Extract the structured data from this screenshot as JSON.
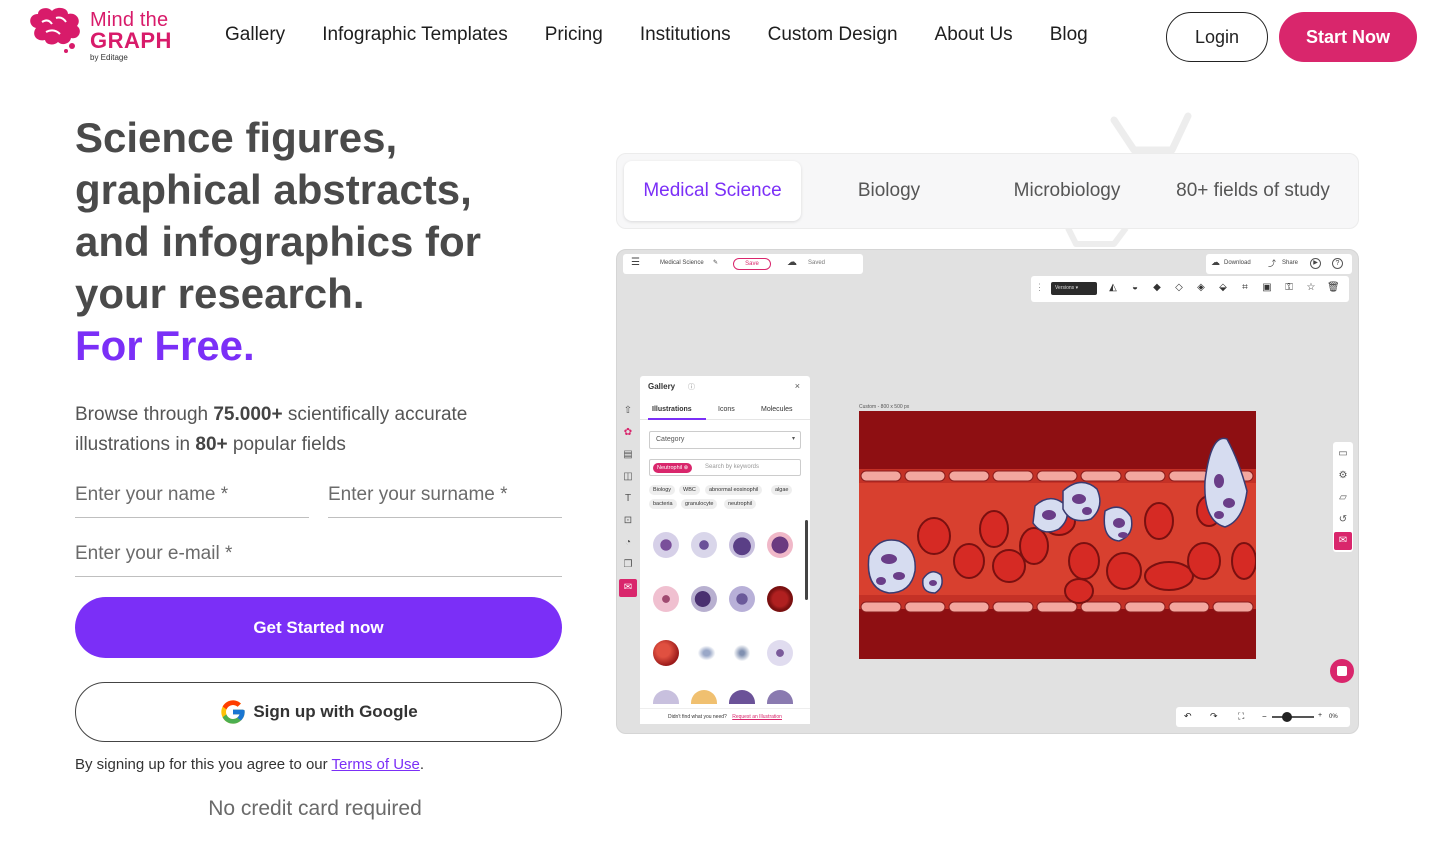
{
  "brand": {
    "line1": "Mind the",
    "line2": "GRAPH",
    "line3": "by Editage",
    "color": "#d81b6a"
  },
  "nav": {
    "items": [
      "Gallery",
      "Infographic Templates",
      "Pricing",
      "Institutions",
      "Custom Design",
      "About Us",
      "Blog"
    ],
    "login": "Login",
    "start": "Start Now"
  },
  "hero": {
    "title_lines": [
      "Science figures,",
      "graphical abstracts,",
      "and infographics for",
      "your research."
    ],
    "title_free": "For Free.",
    "subtitle_pre": "Browse through ",
    "subtitle_count": "75.000+",
    "subtitle_mid": " scientifically accurate illustrations in ",
    "subtitle_fields": "80+",
    "subtitle_post": " popular fields"
  },
  "form": {
    "name_placeholder": "Enter your name *",
    "surname_placeholder": "Enter your surname *",
    "email_placeholder": "Enter your e-mail *",
    "get_started": "Get Started now",
    "google": "Sign up with Google",
    "terms_pre": "By signing up for this you agree to our ",
    "terms_link": "Terms of Use",
    "terms_post": ".",
    "no_card": "No credit card required"
  },
  "preview_tabs": [
    "Medical Science",
    "Biology",
    "Microbiology",
    "80+ fields of study"
  ],
  "app": {
    "doc_title": "Medical Science",
    "save": "Save",
    "saved": "Saved",
    "download": "Download",
    "share": "Share",
    "versions": "Versions",
    "gallery_title": "Gallery",
    "gallery_tabs": [
      "Illustrations",
      "Icons",
      "Molecules"
    ],
    "category": "Category",
    "active_filter": "Neutrophil",
    "search_placeholder": "Search by keywords",
    "chips": [
      "Biology",
      "WBC",
      "abnormal eosinophil",
      "algae",
      "bacteria",
      "granulocyte",
      "neutrophil"
    ],
    "footer_text": "Didn't find what you need?",
    "footer_link": "Request an Illustration",
    "canvas_label": "Custom - 800 x 500 px",
    "zoom": "0%"
  },
  "colors": {
    "purple": "#7b2ff7",
    "pink": "#d9266c"
  }
}
